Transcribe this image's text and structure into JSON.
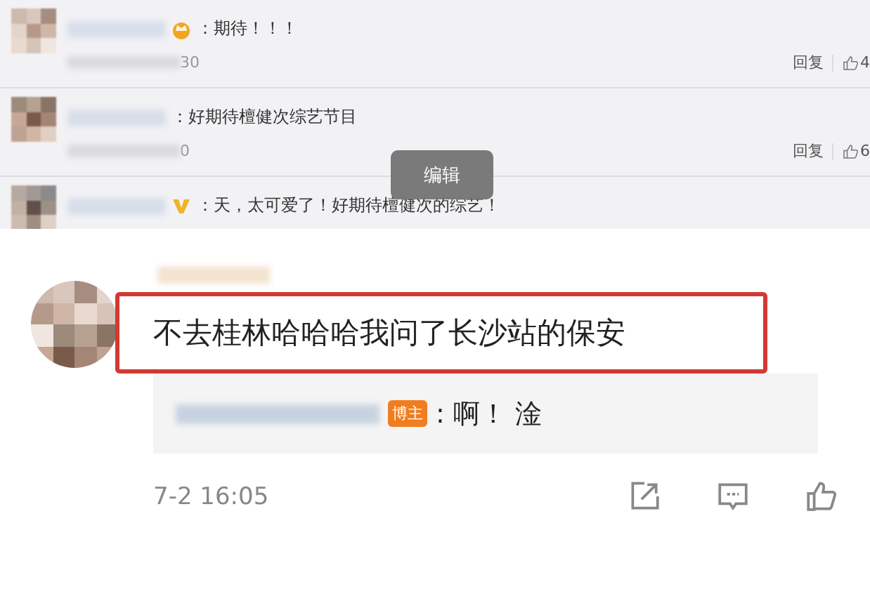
{
  "comments": [
    {
      "kind": "crown",
      "text": "：期待！！！",
      "time": "30",
      "actions": {
        "reply": "回复",
        "likes": "4"
      }
    },
    {
      "text": "：好期待檀健次综艺节目",
      "time": "0",
      "actions": {
        "reply": "回复",
        "likes": "6"
      }
    },
    {
      "kind": "vip",
      "text": "：天，太可爱了！好期待檀健次的综艺！"
    }
  ],
  "tooltip": "编辑",
  "main_comment": {
    "text": "不去桂林哈哈哈我问了长沙站的保安",
    "highlighted": true,
    "reply": {
      "tag": "博主",
      "text": ": 啊！ 淦"
    },
    "time": "7-2 16:05"
  }
}
